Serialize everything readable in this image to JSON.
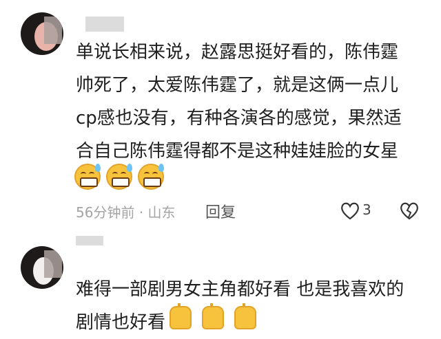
{
  "comments": [
    {
      "text": "单说长相来说，赵露思挺好看的，陈伟霆\n帅死了，太爱陈伟霆了，就是这俩一点儿\ncp感也没有，有种各演各的感觉，果然适\n合自己陈伟霆得都不是这种娃娃脸的女星",
      "emojis": [
        "grinning-sweat-emoji",
        "grinning-sweat-emoji",
        "grinning-sweat-emoji"
      ],
      "time_location": "56分钟前 · 山东",
      "reply_label": "回复",
      "like_count": "3"
    },
    {
      "text": "难得一部剧男女主角都好看 也是我喜欢的\n剧情也好看",
      "emojis": [
        "clapping-hands-emoji",
        "clapping-hands-emoji",
        "clapping-hands-emoji"
      ]
    }
  ],
  "colors": {
    "text": "#1f1f1f",
    "meta": "#a3a3a3",
    "emoji": "#f7c33d"
  }
}
